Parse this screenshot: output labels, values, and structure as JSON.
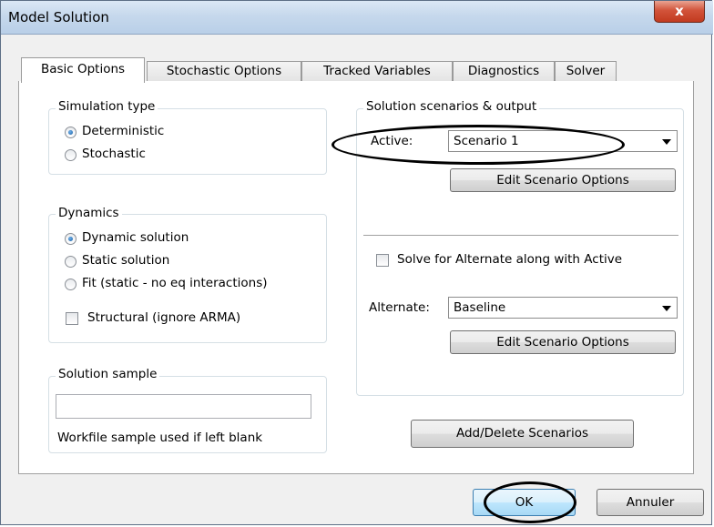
{
  "window": {
    "title": "Model Solution",
    "close_glyph": "x"
  },
  "tabs": [
    {
      "label": "Basic Options",
      "active": true
    },
    {
      "label": "Stochastic Options",
      "active": false
    },
    {
      "label": "Tracked Variables",
      "active": false
    },
    {
      "label": "Diagnostics",
      "active": false
    },
    {
      "label": "Solver",
      "active": false
    }
  ],
  "simulation_type": {
    "legend": "Simulation type",
    "options": [
      {
        "label": "Deterministic",
        "selected": true
      },
      {
        "label": "Stochastic",
        "selected": false
      }
    ]
  },
  "dynamics": {
    "legend": "Dynamics",
    "options": [
      {
        "label": "Dynamic solution",
        "selected": true
      },
      {
        "label": "Static solution",
        "selected": false
      },
      {
        "label": "Fit (static - no eq interactions)",
        "selected": false
      }
    ],
    "structural_checkbox": {
      "label": "Structural (ignore ARMA)",
      "checked": false
    }
  },
  "solution_sample": {
    "legend": "Solution sample",
    "value": "",
    "hint": "Workfile sample used if left blank"
  },
  "scenarios": {
    "legend": "Solution scenarios & output",
    "active_label": "Active:",
    "active_value": "Scenario 1",
    "edit_active_button": "Edit Scenario Options",
    "solve_alternate": {
      "label": "Solve for Alternate along with Active",
      "checked": false
    },
    "alternate_label": "Alternate:",
    "alternate_value": "Baseline",
    "edit_alternate_button": "Edit Scenario Options"
  },
  "add_delete_button": "Add/Delete Scenarios",
  "footer": {
    "ok_label": "OK",
    "cancel_label": "Annuler"
  },
  "colors": {
    "titlebar": "#c6d8ec",
    "close_button": "#c23a1f",
    "default_button_border": "#3c7fb1",
    "annotation_ring": "#000000"
  }
}
